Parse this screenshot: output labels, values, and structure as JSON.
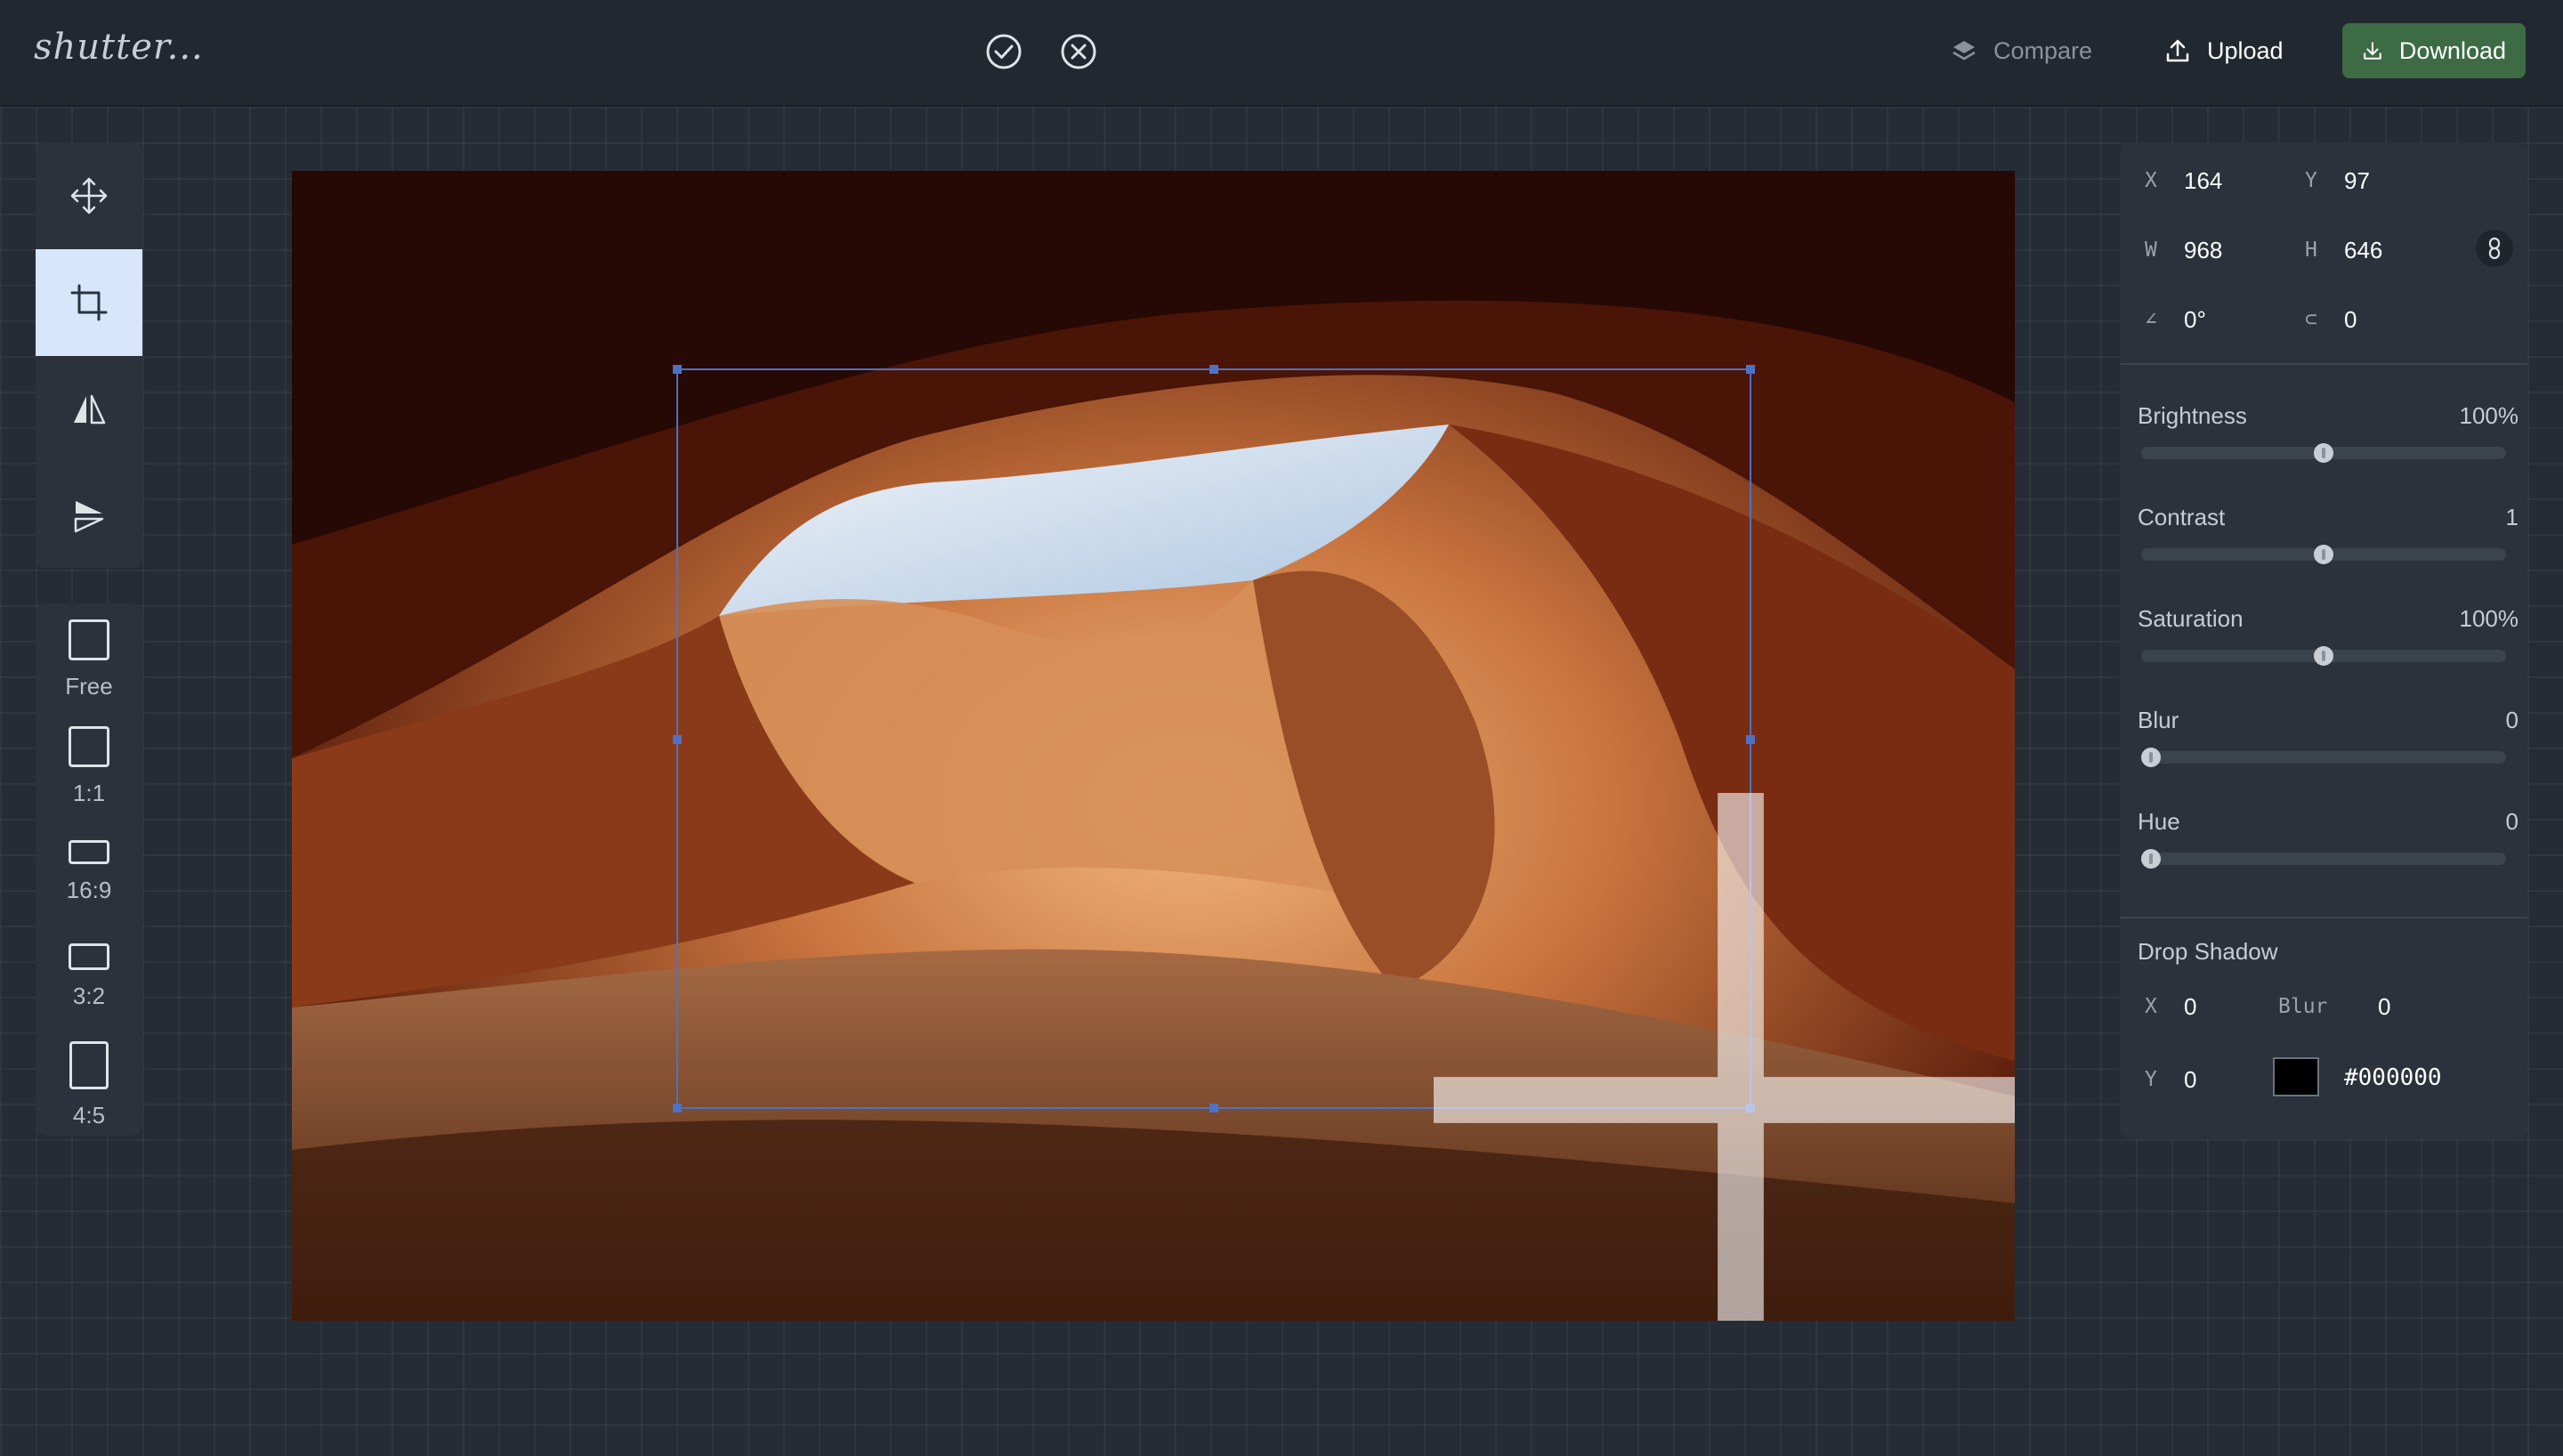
{
  "app": {
    "logo_text": "shutter..."
  },
  "topbar": {
    "confirm_icon": "check-circle-icon",
    "cancel_icon": "x-circle-icon",
    "compare_label": "Compare",
    "upload_label": "Upload",
    "download_label": "Download",
    "download_color": "#3c6b44"
  },
  "tools": [
    {
      "name": "move",
      "icon": "move-arrows-icon",
      "active": false
    },
    {
      "name": "crop",
      "icon": "crop-icon",
      "active": true
    },
    {
      "name": "flip-horizontal",
      "icon": "flip-horizontal-icon",
      "active": false
    },
    {
      "name": "flip-vertical",
      "icon": "flip-vertical-icon",
      "active": false
    }
  ],
  "aspect_ratios": [
    {
      "label": "Free"
    },
    {
      "label": "1:1"
    },
    {
      "label": "16:9"
    },
    {
      "label": "3:2"
    },
    {
      "label": "4:5"
    }
  ],
  "geometry": {
    "x_label": "X",
    "x_value": "164",
    "y_label": "Y",
    "y_value": "97",
    "w_label": "W",
    "w_value": "968",
    "h_label": "H",
    "h_value": "646",
    "angle_label": "∠",
    "angle_value": "0°",
    "corner_label": "⊂",
    "corner_value": "0",
    "link_icon": "link-icon"
  },
  "adjustments": [
    {
      "label": "Brightness",
      "value": "100%",
      "level": 0.5
    },
    {
      "label": "Contrast",
      "value": "1",
      "level": 0.5
    },
    {
      "label": "Saturation",
      "value": "100%",
      "level": 0.5
    },
    {
      "label": "Blur",
      "value": "0",
      "level": 0.0
    },
    {
      "label": "Hue",
      "value": "0",
      "level": 0.0
    }
  ],
  "drop_shadow": {
    "title": "Drop Shadow",
    "x_label": "X",
    "x_value": "0",
    "blur_label": "Blur",
    "blur_value": "0",
    "y_label": "Y",
    "y_value": "0",
    "color": "#000000",
    "color_text": "#000000"
  },
  "colors": {
    "accent_selection": "#4d72c4",
    "active_tool_bg": "#d7e6fb"
  }
}
